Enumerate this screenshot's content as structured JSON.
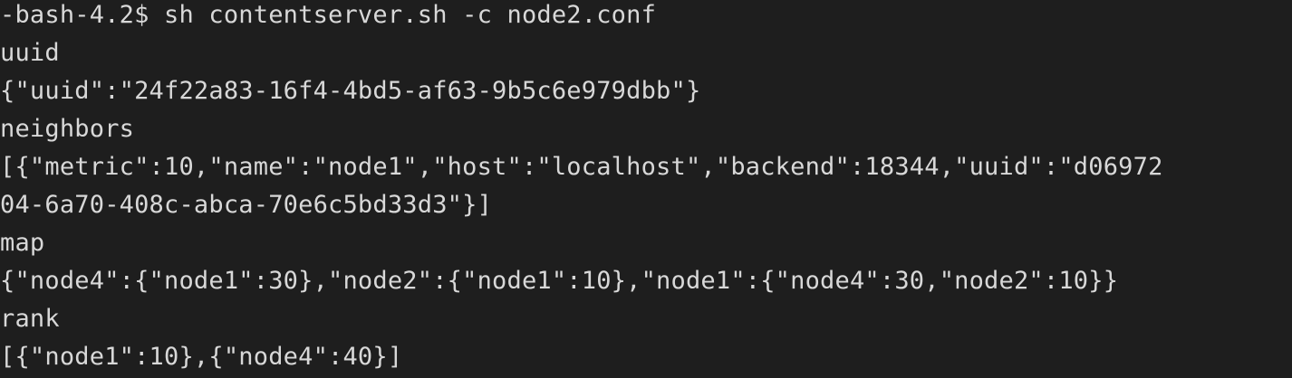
{
  "terminal": {
    "lines": [
      "-bash-4.2$ sh contentserver.sh -c node2.conf",
      "uuid",
      "{\"uuid\":\"24f22a83-16f4-4bd5-af63-9b5c6e979dbb\"}",
      "neighbors",
      "[{\"metric\":10,\"name\":\"node1\",\"host\":\"localhost\",\"backend\":18344,\"uuid\":\"d06972",
      "04-6a70-408c-abca-70e6c5bd33d3\"}]",
      "map",
      "{\"node4\":{\"node1\":30},\"node2\":{\"node1\":10},\"node1\":{\"node4\":30,\"node2\":10}}",
      "rank",
      "[{\"node1\":10},{\"node4\":40}]"
    ],
    "colors": {
      "background": "#1e1e1e",
      "text": "#d8d8d8"
    }
  }
}
